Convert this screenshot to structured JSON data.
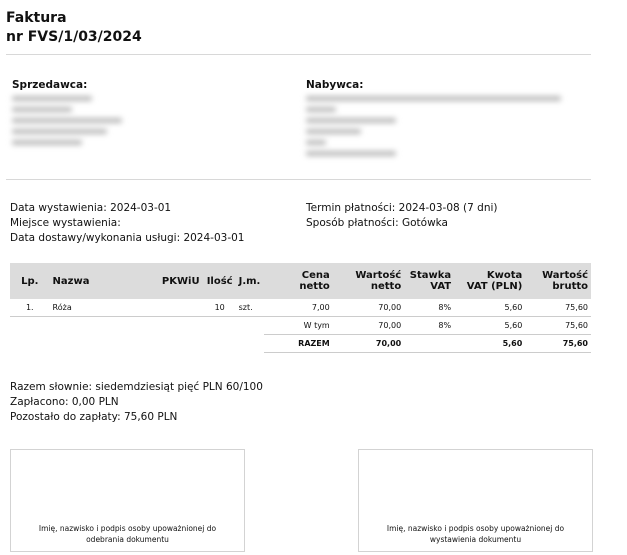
{
  "doc_title": "Faktura",
  "doc_number": "nr FVS/1/03/2024",
  "seller_label": "Sprzedawca:",
  "buyer_label": "Nabywca:",
  "issue_date": "Data wystawienia: 2024-03-01",
  "issue_place": "Miejsce wystawienia:",
  "delivery_date": "Data dostawy/wykonania usługi: 2024-03-01",
  "payment_term": "Termin płatności: 2024-03-08 (7 dni)",
  "payment_method": "Sposób płatności: Gotówka",
  "table": {
    "headers": {
      "lp": "Lp.",
      "name": "Nazwa",
      "pkwiu": "PKWiU",
      "qty": "Ilość",
      "unit": "J.m.",
      "price_1": "Cena",
      "price_2": "netto",
      "net_1": "Wartość",
      "net_2": "netto",
      "rate_1": "Stawka",
      "rate_2": "VAT",
      "vat_1": "Kwota",
      "vat_2": "VAT (PLN)",
      "gross_1": "Wartość",
      "gross_2": "brutto"
    },
    "rows": [
      {
        "lp": "1.",
        "name": "Róża",
        "pkwiu": "",
        "qty": "10",
        "unit": "szt.",
        "price": "7,00",
        "net": "70,00",
        "rate": "8%",
        "vat": "5,60",
        "gross": "75,60"
      }
    ],
    "breakdown": {
      "label": "W tym",
      "net": "70,00",
      "rate": "8%",
      "vat": "5,60",
      "gross": "75,60"
    },
    "total": {
      "label": "RAZEM",
      "net": "70,00",
      "vat": "5,60",
      "gross": "75,60"
    }
  },
  "amount_words": "Razem słownie: siedemdziesiąt pięć PLN 60/100",
  "paid": "Zapłacono: 0,00 PLN",
  "remaining": "Pozostało do zapłaty: 75,60 PLN",
  "sign_receiver": "Imię, nazwisko i podpis osoby upoważnionej do odebrania dokumentu",
  "sign_issuer": "Imię, nazwisko i podpis osoby upoważnionej do wystawienia dokumentu"
}
